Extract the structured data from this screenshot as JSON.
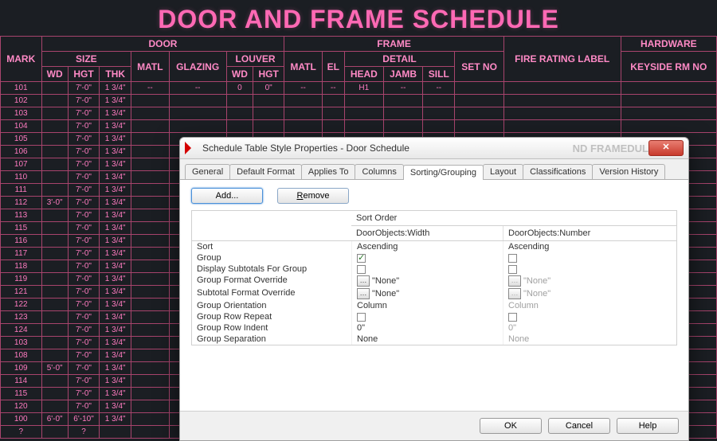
{
  "bg": {
    "title": "DOOR AND FRAME SCHEDULE",
    "top_headers": {
      "mark": "MARK",
      "door": "DOOR",
      "size": "SIZE",
      "wd": "WD",
      "hgt": "HGT",
      "thk": "THK",
      "matl": "MATL",
      "glazing": "GLAZING",
      "louver": "LOUVER",
      "frame": "FRAME",
      "el": "EL",
      "detail": "DETAIL",
      "head": "HEAD",
      "jamb": "JAMB",
      "sill": "SILL",
      "fire": "FIRE RATING LABEL",
      "hardware": "HARDWARE",
      "setno": "SET NO",
      "keyside": "KEYSIDE RM NO"
    },
    "groups": [
      "3'-0\"",
      "5'-0\"",
      "6'-0\""
    ],
    "rows": [
      {
        "mark": "101",
        "wd": "",
        "hgt": "7'-0\"",
        "thk": "1 3/4\"",
        "matl": "--",
        "glz": "--",
        "lwd": "0",
        "lhgt": "0\"",
        "fmatl": "--",
        "el": "--",
        "head": "H1",
        "jamb": "--",
        "sill": "--"
      },
      {
        "mark": "102",
        "wd": "",
        "hgt": "7'-0\"",
        "thk": "1 3/4\""
      },
      {
        "mark": "103",
        "wd": "",
        "hgt": "7'-0\"",
        "thk": "1 3/4\""
      },
      {
        "mark": "104",
        "wd": "",
        "hgt": "7'-0\"",
        "thk": "1 3/4\""
      },
      {
        "mark": "105",
        "wd": "",
        "hgt": "7'-0\"",
        "thk": "1 3/4\""
      },
      {
        "mark": "106",
        "wd": "",
        "hgt": "7'-0\"",
        "thk": "1 3/4\""
      },
      {
        "mark": "107",
        "wd": "",
        "hgt": "7'-0\"",
        "thk": "1 3/4\""
      },
      {
        "mark": "110",
        "wd": "",
        "hgt": "7'-0\"",
        "thk": "1 3/4\""
      },
      {
        "mark": "111",
        "wd": "",
        "hgt": "7'-0\"",
        "thk": "1 3/4\""
      },
      {
        "mark": "112",
        "wd": "3'-0\"",
        "hgt": "7'-0\"",
        "thk": "1 3/4\""
      },
      {
        "mark": "113",
        "wd": "",
        "hgt": "7'-0\"",
        "thk": "1 3/4\""
      },
      {
        "mark": "115",
        "wd": "",
        "hgt": "7'-0\"",
        "thk": "1 3/4\""
      },
      {
        "mark": "116",
        "wd": "",
        "hgt": "7'-0\"",
        "thk": "1 3/4\""
      },
      {
        "mark": "117",
        "wd": "",
        "hgt": "7'-0\"",
        "thk": "1 3/4\""
      },
      {
        "mark": "118",
        "wd": "",
        "hgt": "7'-0\"",
        "thk": "1 3/4\""
      },
      {
        "mark": "119",
        "wd": "",
        "hgt": "7'-0\"",
        "thk": "1 3/4\""
      },
      {
        "mark": "121",
        "wd": "",
        "hgt": "7'-0\"",
        "thk": "1 3/4\""
      },
      {
        "mark": "122",
        "wd": "",
        "hgt": "7'-0\"",
        "thk": "1 3/4\""
      },
      {
        "mark": "123",
        "wd": "",
        "hgt": "7'-0\"",
        "thk": "1 3/4\""
      },
      {
        "mark": "124",
        "wd": "",
        "hgt": "7'-0\"",
        "thk": "1 3/4\""
      },
      {
        "mark": "103",
        "wd": "",
        "hgt": "7'-0\"",
        "thk": "1 3/4\""
      },
      {
        "mark": "108",
        "wd": "",
        "hgt": "7'-0\"",
        "thk": "1 3/4\""
      },
      {
        "mark": "109",
        "wd": "5'-0\"",
        "hgt": "7'-0\"",
        "thk": "1 3/4\""
      },
      {
        "mark": "114",
        "wd": "",
        "hgt": "7'-0\"",
        "thk": "1 3/4\""
      },
      {
        "mark": "115",
        "wd": "",
        "hgt": "7'-0\"",
        "thk": "1 3/4\""
      },
      {
        "mark": "120",
        "wd": "",
        "hgt": "7'-0\"",
        "thk": "1 3/4\""
      },
      {
        "mark": "100",
        "wd": "6'-0\"",
        "hgt": "6'-10\"",
        "thk": "1 3/4\""
      },
      {
        "mark": "?",
        "wd": "",
        "hgt": "?",
        "thk": ""
      }
    ]
  },
  "dialog": {
    "title": "Schedule Table Style Properties - Door Schedule",
    "faded": "ND FRAMEDUL",
    "tabs": [
      "General",
      "Default Format",
      "Applies To",
      "Columns",
      "Sorting/Grouping",
      "Layout",
      "Classifications",
      "Version History"
    ],
    "active_tab": "Sorting/Grouping",
    "add_btn": "Add...",
    "remove_btn": "Remove",
    "sort_order": "Sort Order",
    "col_a": "DoorObjects:Width",
    "col_b": "DoorObjects:Number",
    "rows": {
      "sort": {
        "label": "Sort",
        "a": "Ascending",
        "b": "Ascending"
      },
      "group": {
        "label": "Group",
        "a_checked": true,
        "b_checked": false
      },
      "subtotals": {
        "label": "Display Subtotals For Group",
        "a_checked": false,
        "b_checked": false
      },
      "goverride": {
        "label": "Group Format Override",
        "a": "\"None\"",
        "b": "\"None\"",
        "b_dis": true
      },
      "soverride": {
        "label": "Subtotal Format Override",
        "a": "\"None\"",
        "b": "\"None\"",
        "b_dis": true
      },
      "gorient": {
        "label": "Group Orientation",
        "a": "Column",
        "b": "Column",
        "b_dis": true
      },
      "growrep": {
        "label": "Group Row Repeat",
        "a_checked": false,
        "b_checked": false,
        "b_dis": true
      },
      "gindent": {
        "label": "Group Row Indent",
        "a": "0\"",
        "b": "0\"",
        "b_dis": true
      },
      "gsep": {
        "label": "Group Separation",
        "a": "None",
        "b": "None",
        "b_dis": true
      }
    },
    "footer": {
      "ok": "OK",
      "cancel": "Cancel",
      "help": "Help"
    }
  }
}
